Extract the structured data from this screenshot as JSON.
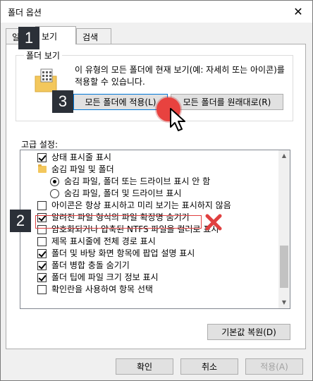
{
  "window": {
    "title": "폴더 옵션",
    "close_glyph": "✕"
  },
  "tabs": [
    {
      "label": "일반"
    },
    {
      "label": "보기"
    },
    {
      "label": "검색"
    }
  ],
  "folder_view": {
    "legend": "폴더 보기",
    "description": "이 유형의 모든 폴더에 현재 보기(예: 자세히 또는 아이콘)를 적용할 수 있습니다.",
    "apply_button": "모든 폴더에 적용(L)",
    "reset_button": "모든 폴더를 원래대로(R)"
  },
  "advanced": {
    "label": "고급 설정:",
    "items": [
      {
        "type": "checkbox",
        "checked": true,
        "label": "상태 표시줄 표시"
      },
      {
        "type": "folder",
        "label": "숨김 파일 및 폴더"
      },
      {
        "type": "radio",
        "checked": true,
        "label": "숨김 파일, 폴더 또는 드라이브 표시 안 함"
      },
      {
        "type": "radio",
        "checked": false,
        "label": "숨김 파일, 폴더 및 드라이브 표시"
      },
      {
        "type": "checkbox",
        "checked": false,
        "label": "아이콘은 항상 표시하고 미리 보기는 표시하지 않음"
      },
      {
        "type": "checkbox",
        "checked": true,
        "label": "알려진 파일 형식의 파일 확장명 숨기기"
      },
      {
        "type": "checkbox",
        "checked": false,
        "label": "암호화되거나 압축된 NTFS 파일을 컬러로 표시"
      },
      {
        "type": "checkbox",
        "checked": false,
        "label": "제목 표시줄에 전체 경로 표시"
      },
      {
        "type": "checkbox",
        "checked": true,
        "label": "폴더 및 바탕 화면 항목에 팝업 설명 표시"
      },
      {
        "type": "checkbox",
        "checked": true,
        "label": "폴더 병합 충돌 숨기기"
      },
      {
        "type": "checkbox",
        "checked": true,
        "label": "폴더 팁에 파일 크기 정보 표시"
      },
      {
        "type": "checkbox",
        "checked": false,
        "label": "확인란을 사용하여 항목 선택"
      }
    ],
    "restore_button": "기본값 복원(D)"
  },
  "footer": {
    "ok": "확인",
    "cancel": "취소",
    "apply": "적용(A)"
  },
  "annotations": {
    "badge_1": "1",
    "badge_2": "2",
    "badge_3": "3"
  },
  "colors": {
    "accent": "#0078d7",
    "badge_bg": "#2b3038",
    "marker_red": "#e04040"
  }
}
